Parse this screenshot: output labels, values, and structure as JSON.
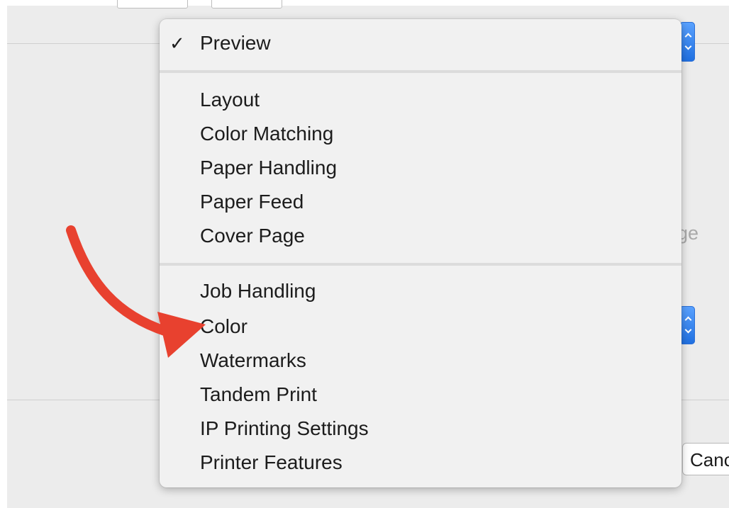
{
  "menu": {
    "items": [
      {
        "label": "Preview",
        "checked": true,
        "check_mark": "✓"
      },
      {
        "label": "Layout",
        "checked": false
      },
      {
        "label": "Color Matching",
        "checked": false
      },
      {
        "label": "Paper Handling",
        "checked": false
      },
      {
        "label": "Paper Feed",
        "checked": false
      },
      {
        "label": "Cover Page",
        "checked": false
      },
      {
        "label": "Job Handling",
        "checked": false
      },
      {
        "label": "Color",
        "checked": false
      },
      {
        "label": "Watermarks",
        "checked": false
      },
      {
        "label": "Tandem Print",
        "checked": false
      },
      {
        "label": "IP Printing Settings",
        "checked": false
      },
      {
        "label": "Printer Features",
        "checked": false
      }
    ]
  },
  "background": {
    "partial_label": "ge",
    "cancel_label": "Cancel"
  },
  "colors": {
    "accent": "#1f6fe0",
    "annotation_arrow": "#e8412f",
    "menu_bg": "#f1f1f1"
  },
  "annotation": {
    "icon": "curved-arrow-icon",
    "points_to": "Color"
  }
}
